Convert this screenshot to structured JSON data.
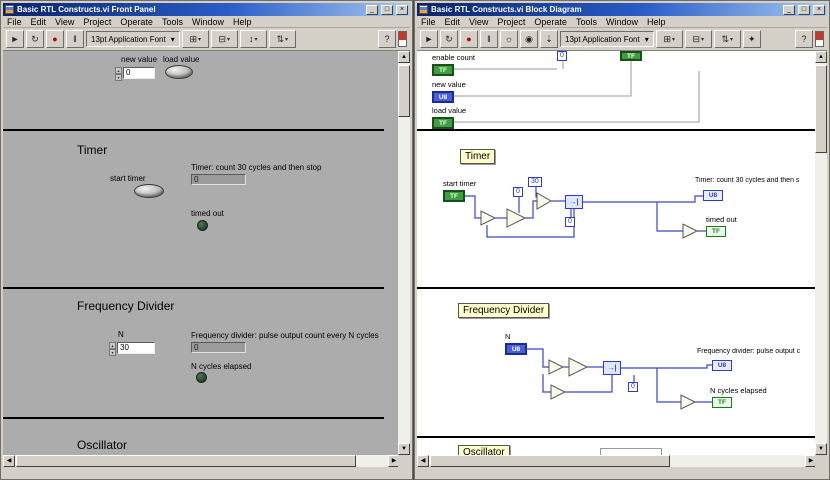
{
  "menu": {
    "items": [
      "File",
      "Edit",
      "View",
      "Project",
      "Operate",
      "Tools",
      "Window",
      "Help"
    ]
  },
  "toolbar": {
    "font_selector": "13pt Application Font"
  },
  "icons": {
    "run": "►",
    "run_continuous": "↻",
    "abort": "●",
    "pause": "‖",
    "highlight_execution": "☼",
    "retain_values": "◉",
    "step_into": "⇣",
    "help": "?",
    "dropdown": "▾",
    "align": "⊞",
    "distribute": "⊟",
    "resize": "↕",
    "reorder": "⇅",
    "clean": "✦",
    "scroll_up": "▲",
    "scroll_down": "▼",
    "scroll_left": "◀",
    "scroll_right": "▶",
    "minimize": "_",
    "maximize": "□",
    "close": "×",
    "spin_up": "▴",
    "spin_down": "▾",
    "feedback": "→|"
  },
  "front_panel": {
    "title": "Basic RTL Constructs.vi Front Panel",
    "controls": {
      "new_value_label": "new value",
      "new_value": "0",
      "load_value_label": "load value"
    },
    "timer": {
      "heading": "Timer",
      "start_timer_label": "start timer",
      "caption": "Timer: count 30 cycles and then stop",
      "value": "0",
      "timed_out_label": "timed out"
    },
    "frequency_divider": {
      "heading": "Frequency Divider",
      "n_label": "N",
      "n_value": "30",
      "caption": "Frequency divider: pulse output count every N cycles",
      "value": "0",
      "elapsed_label": "N cycles elapsed"
    },
    "oscillator": {
      "heading": "Oscillator"
    }
  },
  "block_diagram": {
    "title": "Basic RTL Constructs.vi Block Diagram",
    "labels": {
      "enable_count": "enable count",
      "new_value": "new value",
      "load_value": "load value",
      "start_timer": "start timer",
      "timer_caption": "Timer: count 30 cycles and then s",
      "timed_out": "timed out",
      "n": "N",
      "freq_caption": "Frequency divider: pulse output c",
      "n_cycles_elapsed": "N cycles elapsed"
    },
    "sections": {
      "timer": "Timer",
      "frequency_divider": "Frequency Divider",
      "oscillator": "Oscillator"
    },
    "constants": {
      "thirty": "30",
      "zero": "0"
    },
    "terminals": {
      "tf": "TF",
      "u8": "U8"
    },
    "colors": {
      "boolean_green": "#3f9e3f",
      "numeric_blue": "#4c5fd8",
      "wire_blue": "#3846c8",
      "label_yellow": "#ffffcc",
      "titlebar_blue": "#0a246a"
    }
  }
}
